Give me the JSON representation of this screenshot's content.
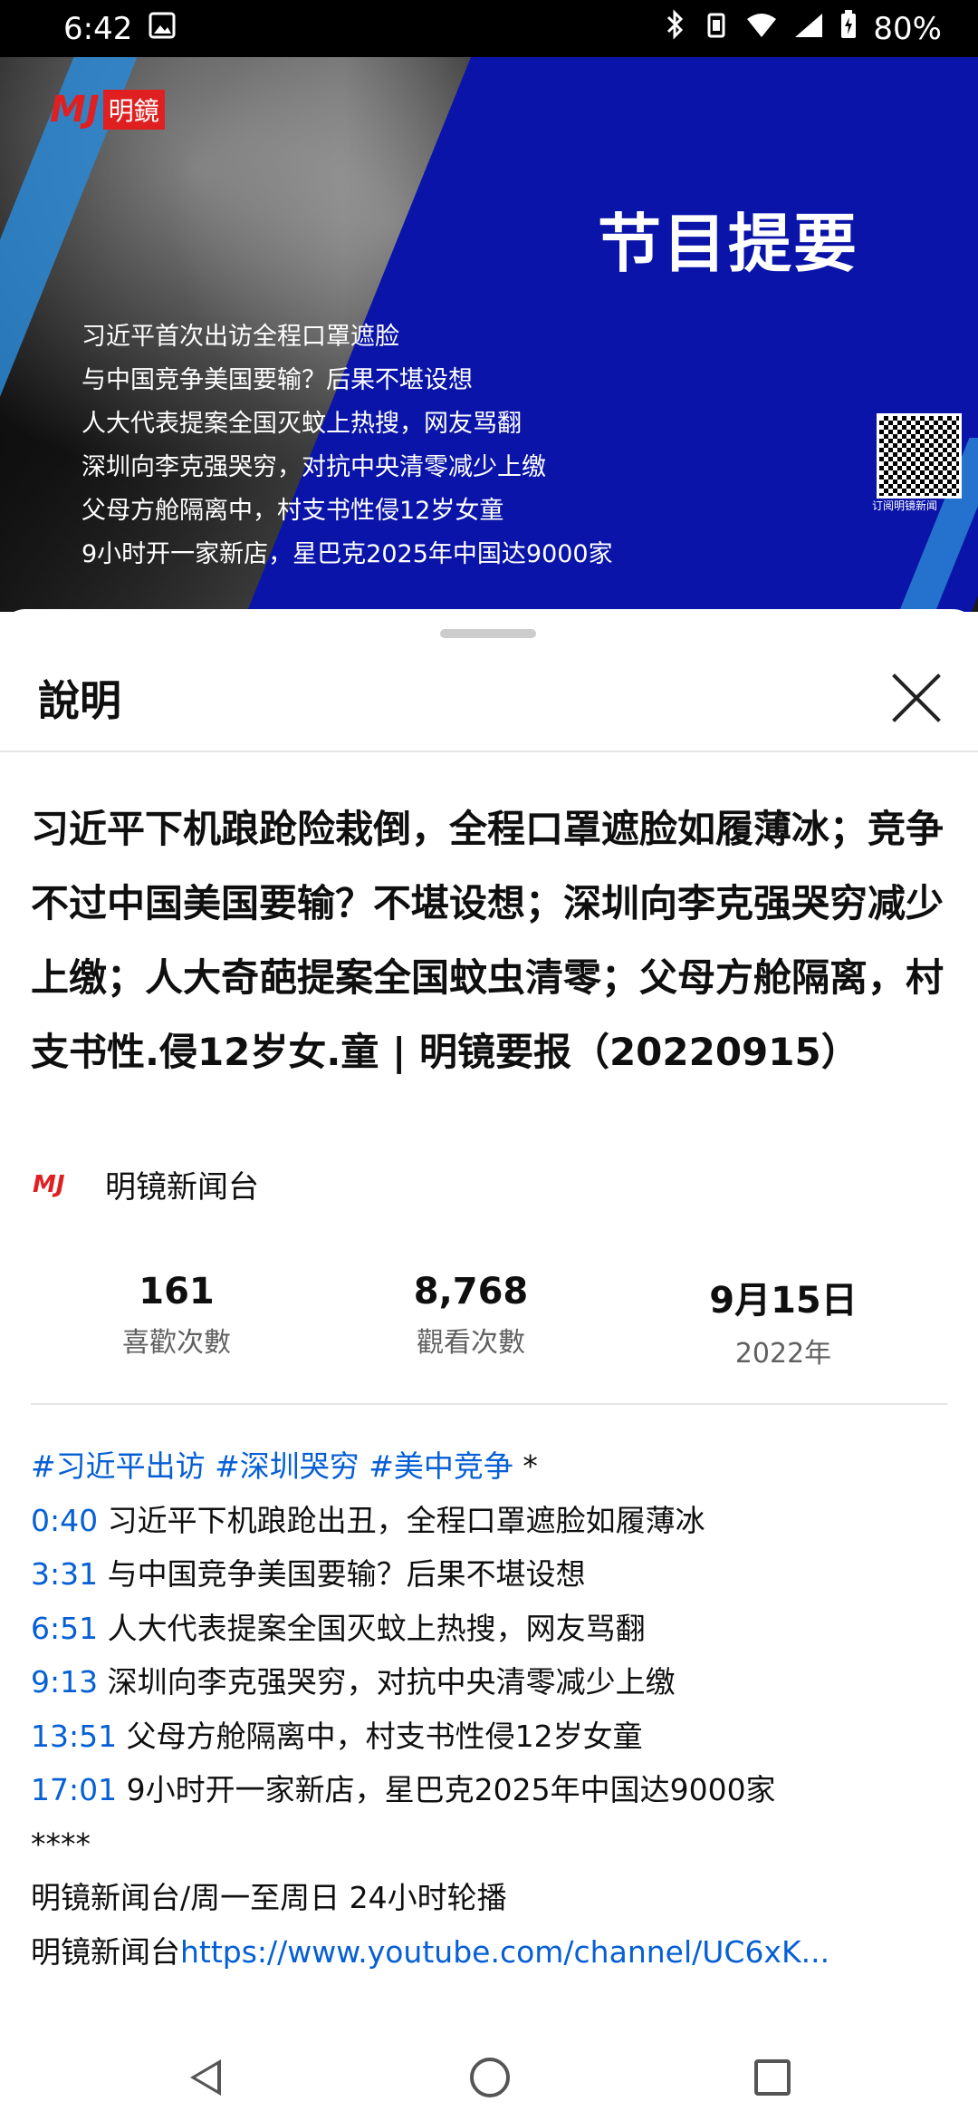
{
  "status": {
    "time": "6:42",
    "battery": "80%"
  },
  "video": {
    "logo_mark": "MJ",
    "logo_text": "明鏡",
    "program_title": "节目提要",
    "bullets": [
      "习近平首次出访全程口罩遮脸",
      "与中国竞争美国要输？后果不堪设想",
      "人大代表提案全国灭蚊上热搜，网友骂翻",
      "深圳向李克强哭穷，对抗中央清零减少上缴",
      "父母方舱隔离中，村支书性侵12岁女童",
      "9小时开一家新店，星巴克2025年中国达9000家"
    ],
    "qr_caption": "订阅明镜新闻",
    "progress_fraction": 0.06
  },
  "sheet": {
    "title": "說明",
    "video_title": "习近平下机踉跄险栽倒，全程口罩遮脸如履薄冰；竞争不过中国美国要输？不堪设想；深圳向李克强哭穷减少上缴；人大奇葩提案全国蚊虫清零；父母方舱隔离，村支书性.侵12岁女.童 | 明镜要报（20220915）",
    "channel_logo": "MJ",
    "channel_name": "明镜新闻台",
    "stats": [
      {
        "value": "161",
        "label": "喜歡次數"
      },
      {
        "value": "8,768",
        "label": "觀看次數"
      },
      {
        "value": "9月15日",
        "label": "2022年"
      }
    ],
    "hashtags": "#习近平出访 #深圳哭穷 #美中竞争",
    "hashtags_suffix": " *",
    "timestamps": [
      {
        "time": "0:40",
        "text": " 习近平下机踉跄出丑，全程口罩遮脸如履薄冰"
      },
      {
        "time": "3:31",
        "text": " 与中国竞争美国要输？后果不堪设想"
      },
      {
        "time": "6:51",
        "text": " 人大代表提案全国灭蚊上热搜，网友骂翻"
      },
      {
        "time": "9:13",
        "text": " 深圳向李克强哭穷，对抗中央清零减少上缴"
      },
      {
        "time": "13:51",
        "text": " 父母方舱隔离中，村支书性侵12岁女童"
      },
      {
        "time": "17:01",
        "text": " 9小时开一家新店，星巴克2025年中国达9000家"
      }
    ],
    "stars": "****",
    "schedule": "明镜新闻台/周一至周日 24小时轮播",
    "channel_prefix": "明镜新闻台",
    "channel_link": "https://www.youtube.com/channel/UC6xK..."
  }
}
